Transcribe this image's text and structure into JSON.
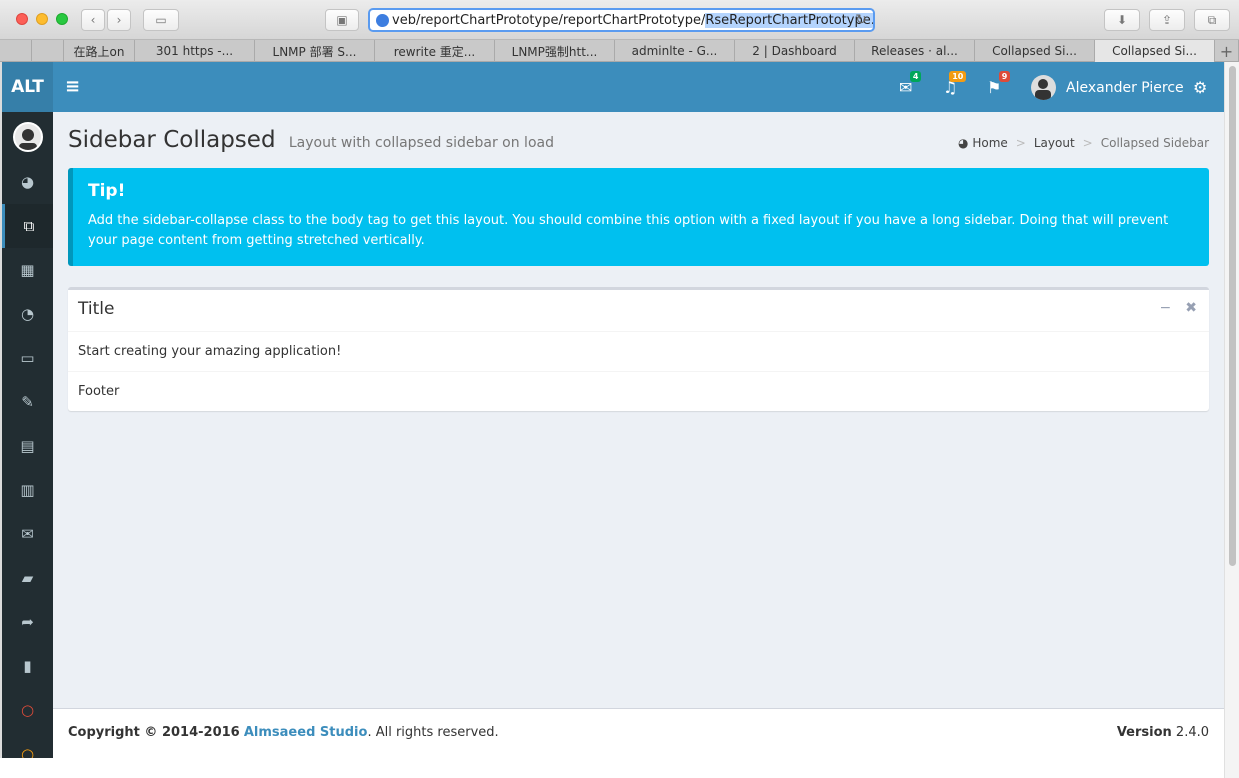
{
  "browser": {
    "url_prefix": "veb/reportChartPrototype/reportChartPrototype/",
    "url_selected": "RseReportChartPrototype.html",
    "tabs": [
      "在路上on",
      "301 https -...",
      "LNMP 部署 S...",
      "rewrite 重定...",
      "LNMP强制htt...",
      "adminlte - G...",
      "2 | Dashboard",
      "Releases · al...",
      "Collapsed Si...",
      "Collapsed Si..."
    ],
    "new_tab": "+"
  },
  "app": {
    "logo": "ALT",
    "messages_count": "4",
    "notifications_count": "10",
    "tasks_count": "9",
    "user_name": "Alexander Pierce"
  },
  "page": {
    "title": "Sidebar Collapsed",
    "subtitle": "Layout with collapsed sidebar on load",
    "breadcrumb": {
      "home": "Home",
      "sep": ">",
      "layout": "Layout",
      "current": "Collapsed Sidebar"
    }
  },
  "callout": {
    "title": "Tip!",
    "text": "Add the sidebar-collapse class to the body tag to get this layout. You should combine this option with a fixed layout if you have a long sidebar. Doing that will prevent your page content from getting stretched vertically."
  },
  "box": {
    "title": "Title",
    "body": "Start creating your amazing application!",
    "footer": "Footer"
  },
  "footer": {
    "copyright": "Copyright © 2014-2016",
    "company": "Almsaeed Studio",
    "rights": ". All rights reserved.",
    "version_label": "Version",
    "version": "2.4.0"
  }
}
